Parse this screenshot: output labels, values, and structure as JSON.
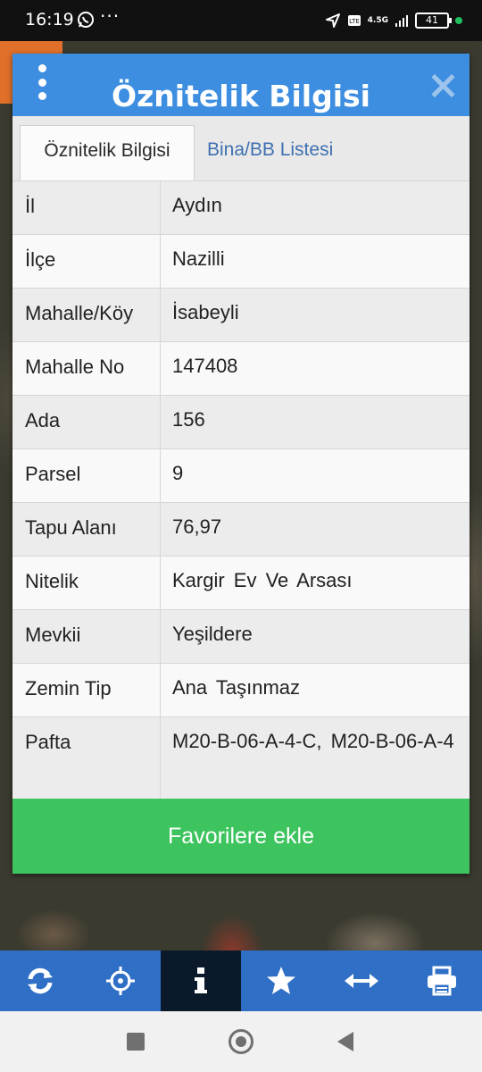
{
  "status_bar": {
    "time": "16:19",
    "network": "4.5G",
    "battery": "41"
  },
  "dialog": {
    "title": "Öznitelik Bilgisi",
    "tabs": [
      {
        "label": "Öznitelik Bilgisi",
        "active": true
      },
      {
        "label": "Bina/BB Listesi",
        "active": false
      }
    ],
    "rows": [
      {
        "key": "İl",
        "value": "Aydın"
      },
      {
        "key": "İlçe",
        "value": "Nazilli"
      },
      {
        "key": "Mahalle/Köy",
        "value": "İsabeyli"
      },
      {
        "key": "Mahalle No",
        "value": "147408"
      },
      {
        "key": "Ada",
        "value": "156"
      },
      {
        "key": "Parsel",
        "value": "9"
      },
      {
        "key": "Tapu Alanı",
        "value": "76,97"
      },
      {
        "key": "Nitelik",
        "value": "Kargir Ev Ve Arsası"
      },
      {
        "key": "Mevkii",
        "value": "Yeşildere"
      },
      {
        "key": "Zemin Tip",
        "value": "Ana Taşınmaz"
      },
      {
        "key": "Pafta",
        "value": "M20-B-06-A-4-C, M20-B-06-A-4"
      }
    ],
    "favorite_button": "Favorilere ekle"
  },
  "toolbar": {
    "items": [
      {
        "icon": "refresh-icon"
      },
      {
        "icon": "crosshair-icon"
      },
      {
        "icon": "info-icon",
        "selected": true
      },
      {
        "icon": "star-icon"
      },
      {
        "icon": "measure-arrows-icon"
      },
      {
        "icon": "print-icon"
      }
    ]
  },
  "colors": {
    "header": "#3d8ee0",
    "favorite_button": "#3ec45e",
    "toolbar": "#2f6fc6",
    "tab_inactive_text": "#3f6fb0"
  }
}
